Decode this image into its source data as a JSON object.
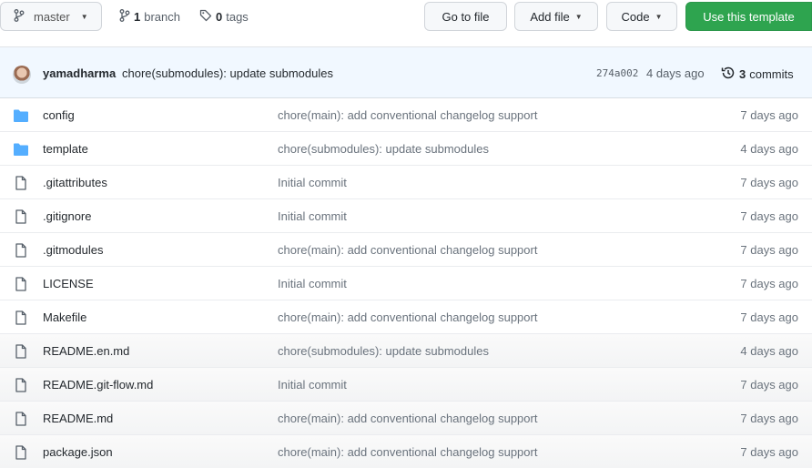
{
  "toolbar": {
    "branch_label": "master",
    "branch_count": "1",
    "branch_word": "branch",
    "tag_count": "0",
    "tag_word": "tags",
    "goto_label": "Go to file",
    "addfile_label": "Add file",
    "code_label": "Code",
    "template_label": "Use this template"
  },
  "colors": {
    "primary_green": "#2ea44f",
    "folder_blue": "#54aeff",
    "commit_bar_bg": "#f1f8ff"
  },
  "commit": {
    "author": "yamadharma",
    "message": "chore(submodules): update submodules",
    "sha": "274a002",
    "age": "4 days ago",
    "commits_count": "3",
    "commits_word": "commits"
  },
  "files": [
    {
      "type": "folder",
      "icon": "folder-icon",
      "name": "config",
      "message": "chore(main): add conventional changelog support",
      "age": "7 days ago"
    },
    {
      "type": "folder",
      "icon": "folder-icon",
      "name": "template",
      "message": "chore(submodules): update submodules",
      "age": "4 days ago"
    },
    {
      "type": "file",
      "icon": "file-icon",
      "name": ".gitattributes",
      "message": "Initial commit",
      "age": "7 days ago"
    },
    {
      "type": "file",
      "icon": "file-icon",
      "name": ".gitignore",
      "message": "Initial commit",
      "age": "7 days ago"
    },
    {
      "type": "file",
      "icon": "file-icon",
      "name": ".gitmodules",
      "message": "chore(main): add conventional changelog support",
      "age": "7 days ago"
    },
    {
      "type": "file",
      "icon": "file-icon",
      "name": "LICENSE",
      "message": "Initial commit",
      "age": "7 days ago"
    },
    {
      "type": "file",
      "icon": "file-icon",
      "name": "Makefile",
      "message": "chore(main): add conventional changelog support",
      "age": "7 days ago"
    },
    {
      "type": "file",
      "icon": "file-icon",
      "name": "README.en.md",
      "message": "chore(submodules): update submodules",
      "age": "4 days ago"
    },
    {
      "type": "file",
      "icon": "file-icon",
      "name": "README.git-flow.md",
      "message": "Initial commit",
      "age": "7 days ago"
    },
    {
      "type": "file",
      "icon": "file-icon",
      "name": "README.md",
      "message": "chore(main): add conventional changelog support",
      "age": "7 days ago"
    },
    {
      "type": "file",
      "icon": "file-icon",
      "name": "package.json",
      "message": "chore(main): add conventional changelog support",
      "age": "7 days ago"
    }
  ]
}
